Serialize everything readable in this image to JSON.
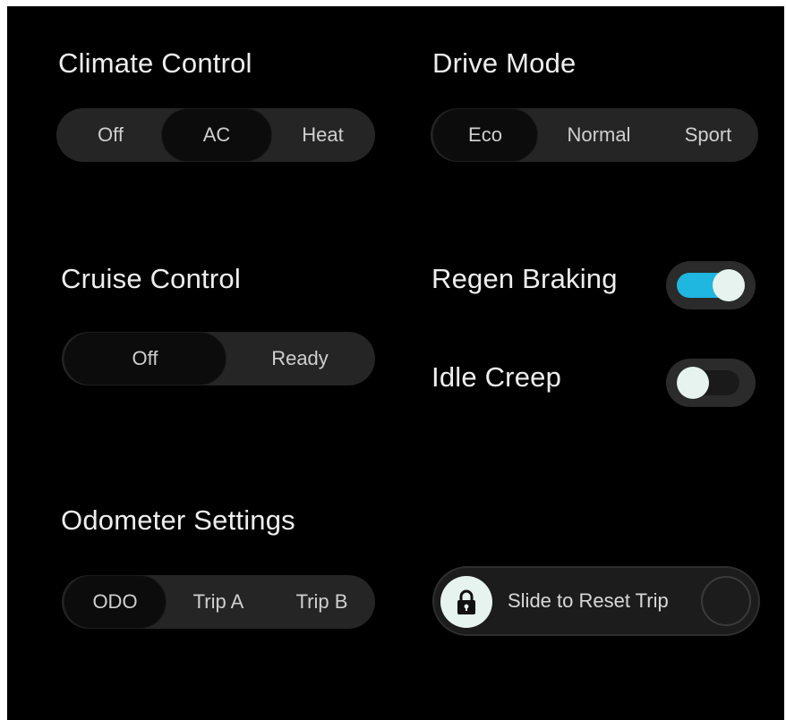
{
  "climate": {
    "title": "Climate Control",
    "options": [
      "Off",
      "AC",
      "Heat"
    ],
    "selected": "AC"
  },
  "drive": {
    "title": "Drive Mode",
    "options": [
      "Eco",
      "Normal",
      "Sport"
    ],
    "selected": "Eco"
  },
  "cruise": {
    "title": "Cruise Control",
    "options": [
      "Off",
      "Ready"
    ],
    "selected": "Off"
  },
  "regen": {
    "label": "Regen Braking",
    "state": "on"
  },
  "idle": {
    "label": "Idle Creep",
    "state": "off"
  },
  "odometer": {
    "title": "Odometer Settings",
    "options": [
      "ODO",
      "Trip A",
      "Trip B"
    ],
    "selected": "ODO"
  },
  "reset_trip": {
    "label": "Slide to Reset Trip",
    "icon": "lock-icon"
  },
  "colors": {
    "background": "#000000",
    "accent": "#1fb6e0",
    "knob": "#e6f3ee",
    "segment_track": "#252525",
    "text": "#eeeeee"
  }
}
